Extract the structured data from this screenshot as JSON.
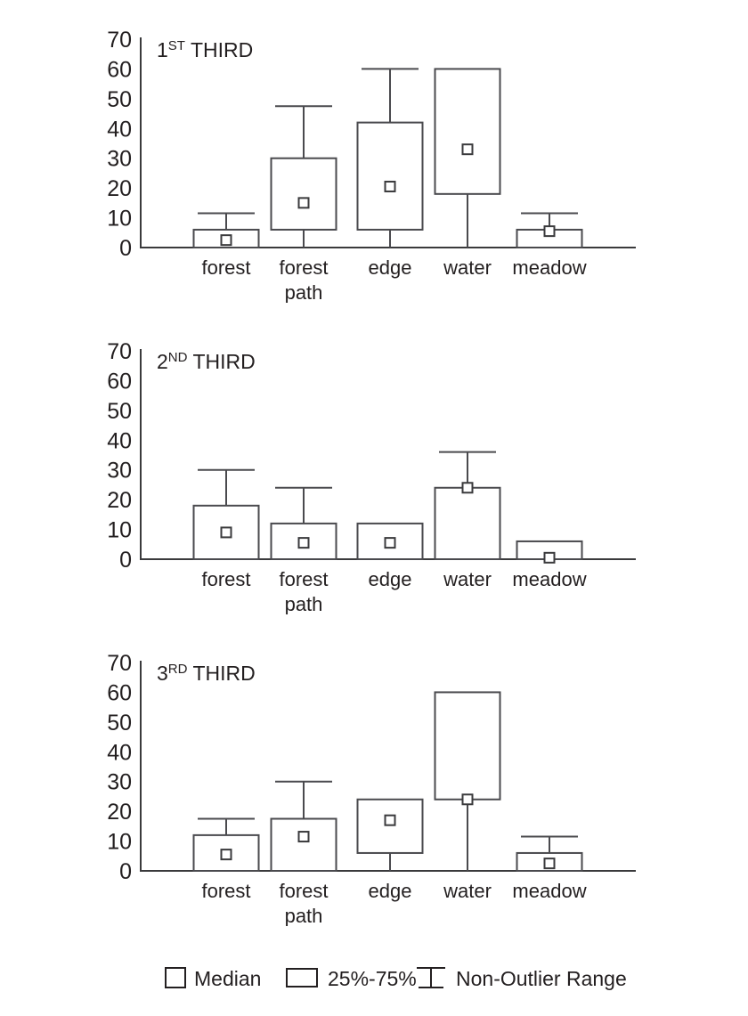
{
  "figure": {
    "title": "",
    "y_tick_labels": [
      "70",
      "60",
      "50",
      "40",
      "30",
      "20",
      "10",
      "0"
    ],
    "categories": [
      "forest",
      "forest path",
      "edge",
      "water",
      "meadow"
    ]
  },
  "legend": {
    "items": [
      {
        "symbol": "median-square-icon",
        "label": "Median"
      },
      {
        "symbol": "box-rect-icon",
        "label": "25%-75%"
      },
      {
        "symbol": "whisker-icon",
        "label": "Non-Outlier Range"
      }
    ]
  },
  "panels": [
    {
      "id": "first-third",
      "title_main": "1",
      "title_sup": "ST",
      "title_rest": "THIRD"
    },
    {
      "id": "second-third",
      "title_main": "2",
      "title_sup": "ND",
      "title_rest": "THIRD"
    },
    {
      "id": "third-third",
      "title_main": "3",
      "title_sup": "RD",
      "title_rest": "THIRD"
    }
  ],
  "chart_data": [
    {
      "type": "box",
      "title": "1ST THIRD",
      "xlabel": "",
      "ylabel": "",
      "ylim": [
        0,
        70
      ],
      "yticks": [
        0,
        10,
        20,
        30,
        40,
        50,
        60,
        70
      ],
      "grid": false,
      "categories": [
        "forest",
        "forest path",
        "edge",
        "water",
        "meadow"
      ],
      "boxes": [
        {
          "category": "forest",
          "q1": 0,
          "q3": 6,
          "median": 2.5,
          "whisker_low": 0,
          "whisker_high": 11.5
        },
        {
          "category": "forest path",
          "q1": 6,
          "q3": 30,
          "median": 15,
          "whisker_low": 0,
          "whisker_high": 47.5
        },
        {
          "category": "edge",
          "q1": 6,
          "q3": 42,
          "median": 20.5,
          "whisker_low": 0,
          "whisker_high": 60
        },
        {
          "category": "water",
          "q1": 18,
          "q3": 60,
          "median": 33,
          "whisker_low": 0,
          "whisker_high": 60
        },
        {
          "category": "meadow",
          "q1": 0,
          "q3": 6,
          "median": 5.5,
          "whisker_low": 0,
          "whisker_high": 11.5
        }
      ]
    },
    {
      "type": "box",
      "title": "2ND THIRD",
      "xlabel": "",
      "ylabel": "",
      "ylim": [
        0,
        70
      ],
      "yticks": [
        0,
        10,
        20,
        30,
        40,
        50,
        60,
        70
      ],
      "grid": false,
      "categories": [
        "forest",
        "forest path",
        "edge",
        "water",
        "meadow"
      ],
      "boxes": [
        {
          "category": "forest",
          "q1": 0,
          "q3": 18,
          "median": 9,
          "whisker_low": 0,
          "whisker_high": 30
        },
        {
          "category": "forest path",
          "q1": 0,
          "q3": 12,
          "median": 5.5,
          "whisker_low": 0,
          "whisker_high": 24
        },
        {
          "category": "edge",
          "q1": 0,
          "q3": 12,
          "median": 5.5,
          "whisker_low": 0,
          "whisker_high": 12
        },
        {
          "category": "water",
          "q1": 0,
          "q3": 24,
          "median": 24,
          "whisker_low": 0,
          "whisker_high": 36
        },
        {
          "category": "meadow",
          "q1": 0,
          "q3": 6,
          "median": 0.5,
          "whisker_low": 0,
          "whisker_high": 6
        }
      ]
    },
    {
      "type": "box",
      "title": "3RD THIRD",
      "xlabel": "",
      "ylabel": "",
      "ylim": [
        0,
        70
      ],
      "yticks": [
        0,
        10,
        20,
        30,
        40,
        50,
        60,
        70
      ],
      "grid": false,
      "categories": [
        "forest",
        "forest path",
        "edge",
        "water",
        "meadow"
      ],
      "boxes": [
        {
          "category": "forest",
          "q1": 0,
          "q3": 12,
          "median": 5.5,
          "whisker_low": 0,
          "whisker_high": 17.5
        },
        {
          "category": "forest path",
          "q1": 0,
          "q3": 17.5,
          "median": 11.5,
          "whisker_low": 0,
          "whisker_high": 30
        },
        {
          "category": "edge",
          "q1": 6,
          "q3": 24,
          "median": 17,
          "whisker_low": 0,
          "whisker_high": 24
        },
        {
          "category": "water",
          "q1": 24,
          "q3": 60,
          "median": 24,
          "whisker_low": 0,
          "whisker_high": 60
        },
        {
          "category": "meadow",
          "q1": 0,
          "q3": 6,
          "median": 2.5,
          "whisker_low": 0,
          "whisker_high": 11.5
        }
      ]
    }
  ]
}
